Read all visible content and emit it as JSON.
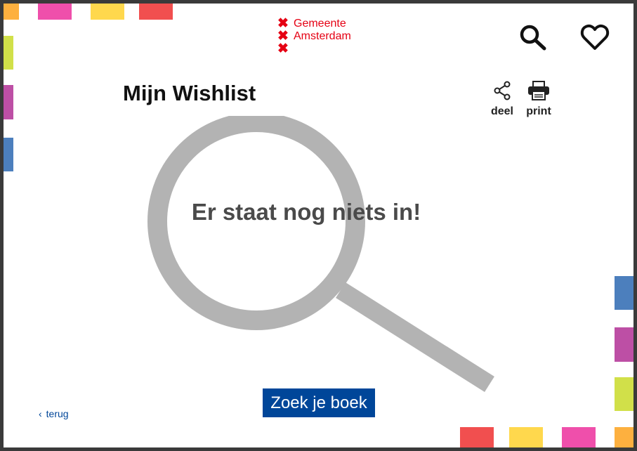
{
  "logo": {
    "line1": "Gemeente",
    "line2": "Amsterdam",
    "cross_glyph": "✖",
    "color": "#e50013"
  },
  "header": {
    "search_icon": "search-icon",
    "wishlist_icon": "heart-icon"
  },
  "page": {
    "title": "Mijn Wishlist",
    "share_label": "deel",
    "print_label": "print",
    "empty_message": "Er staat nog niets in!",
    "cta_label": "Zoek je boek",
    "back_label": "terug",
    "back_icon": "chevron-left-icon"
  },
  "colors": {
    "orange": "#fdb03f",
    "pink": "#ef4fab",
    "yellow": "#ffd84d",
    "red": "#f14f4f",
    "lime": "#d1e049",
    "magenta": "#bd4fa5",
    "blue": "#4c7fbd",
    "brand_blue": "#004699",
    "illustration_gray": "#b3b3b3"
  }
}
